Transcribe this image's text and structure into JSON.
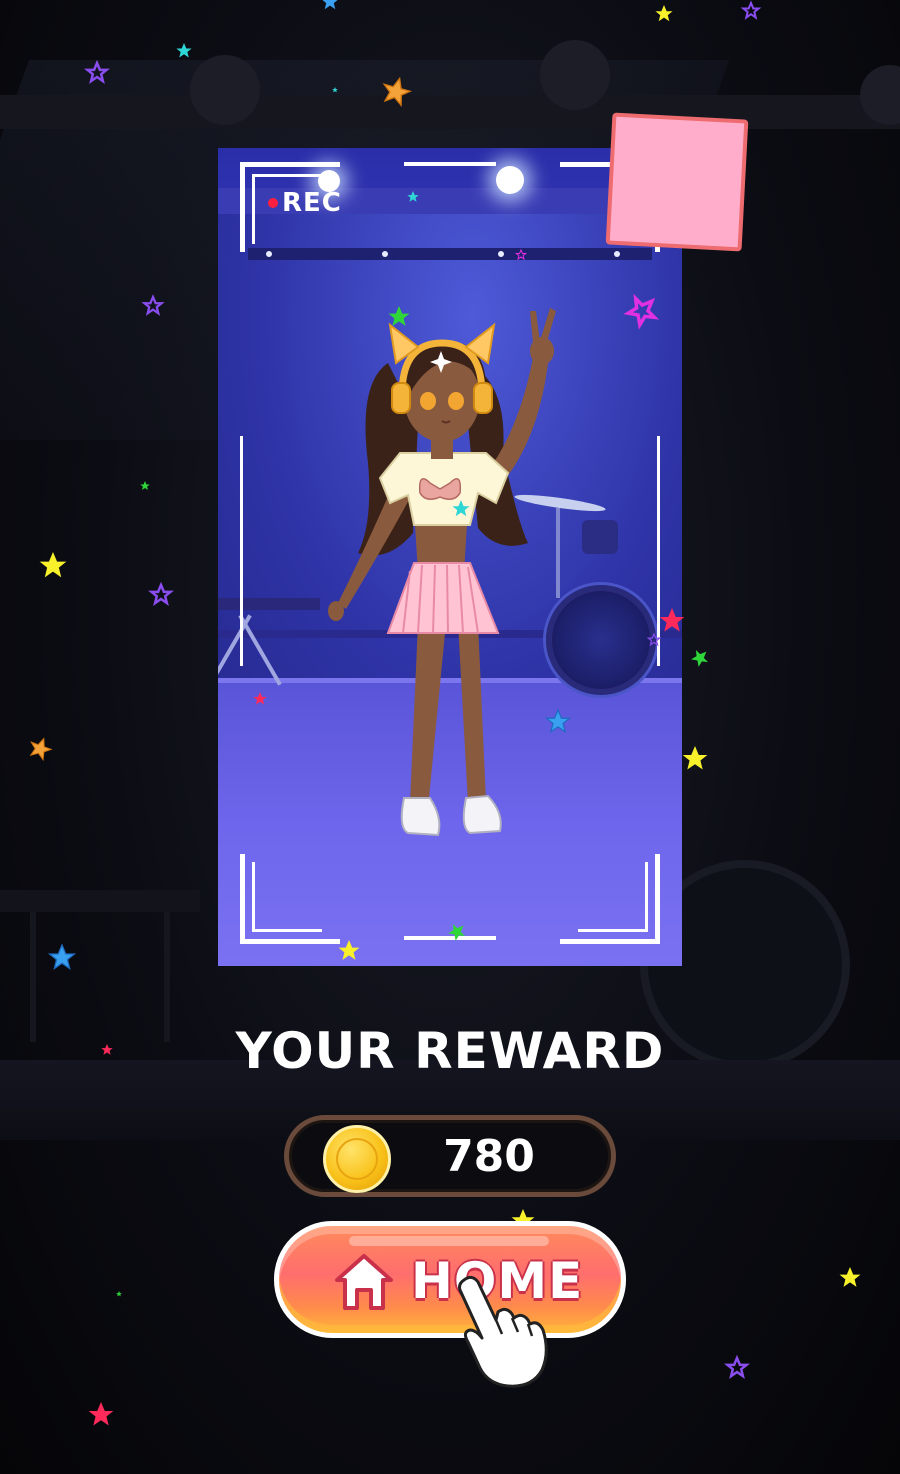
{
  "photo": {
    "rec_label": "REC"
  },
  "reward": {
    "title": "YOUR REWARD",
    "coin_amount": "780"
  },
  "home_button": {
    "label": "HOME"
  },
  "colors": {
    "background": "#050508",
    "stage_purple": "#4d45d6",
    "sticky_pink": "#ffadca",
    "sticky_border": "#ee6c70",
    "coin_gold": "#f9c21a",
    "button_orange": "#ff6e6e"
  },
  "icons": {
    "rec_indicator": "red-dot-icon",
    "coin": "gold-coin-icon",
    "home": "house-icon",
    "pointer": "pointing-hand-icon"
  }
}
